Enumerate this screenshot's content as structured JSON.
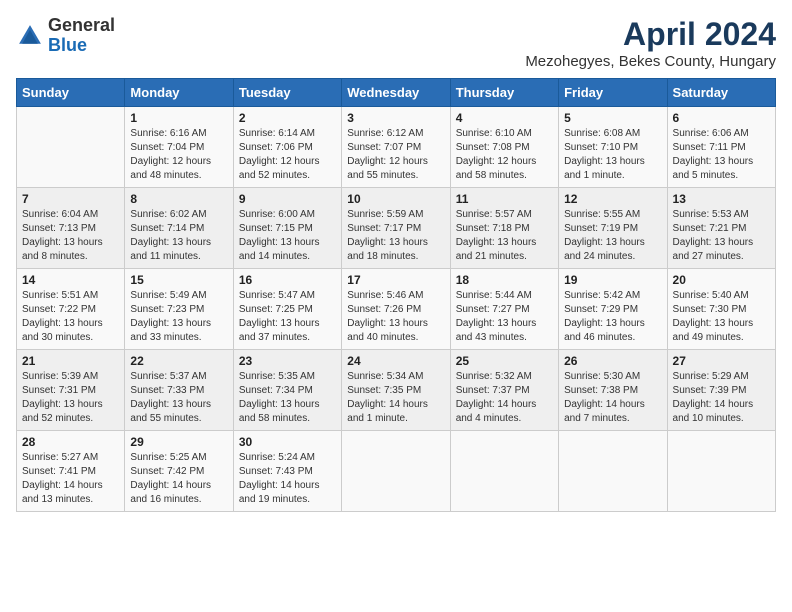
{
  "logo": {
    "general": "General",
    "blue": "Blue"
  },
  "header": {
    "title": "April 2024",
    "subtitle": "Mezohegyes, Bekes County, Hungary"
  },
  "weekdays": [
    "Sunday",
    "Monday",
    "Tuesday",
    "Wednesday",
    "Thursday",
    "Friday",
    "Saturday"
  ],
  "weeks": [
    [
      {
        "day": "",
        "sunrise": "",
        "sunset": "",
        "daylight": ""
      },
      {
        "day": "1",
        "sunrise": "Sunrise: 6:16 AM",
        "sunset": "Sunset: 7:04 PM",
        "daylight": "Daylight: 12 hours and 48 minutes."
      },
      {
        "day": "2",
        "sunrise": "Sunrise: 6:14 AM",
        "sunset": "Sunset: 7:06 PM",
        "daylight": "Daylight: 12 hours and 52 minutes."
      },
      {
        "day": "3",
        "sunrise": "Sunrise: 6:12 AM",
        "sunset": "Sunset: 7:07 PM",
        "daylight": "Daylight: 12 hours and 55 minutes."
      },
      {
        "day": "4",
        "sunrise": "Sunrise: 6:10 AM",
        "sunset": "Sunset: 7:08 PM",
        "daylight": "Daylight: 12 hours and 58 minutes."
      },
      {
        "day": "5",
        "sunrise": "Sunrise: 6:08 AM",
        "sunset": "Sunset: 7:10 PM",
        "daylight": "Daylight: 13 hours and 1 minute."
      },
      {
        "day": "6",
        "sunrise": "Sunrise: 6:06 AM",
        "sunset": "Sunset: 7:11 PM",
        "daylight": "Daylight: 13 hours and 5 minutes."
      }
    ],
    [
      {
        "day": "7",
        "sunrise": "Sunrise: 6:04 AM",
        "sunset": "Sunset: 7:13 PM",
        "daylight": "Daylight: 13 hours and 8 minutes."
      },
      {
        "day": "8",
        "sunrise": "Sunrise: 6:02 AM",
        "sunset": "Sunset: 7:14 PM",
        "daylight": "Daylight: 13 hours and 11 minutes."
      },
      {
        "day": "9",
        "sunrise": "Sunrise: 6:00 AM",
        "sunset": "Sunset: 7:15 PM",
        "daylight": "Daylight: 13 hours and 14 minutes."
      },
      {
        "day": "10",
        "sunrise": "Sunrise: 5:59 AM",
        "sunset": "Sunset: 7:17 PM",
        "daylight": "Daylight: 13 hours and 18 minutes."
      },
      {
        "day": "11",
        "sunrise": "Sunrise: 5:57 AM",
        "sunset": "Sunset: 7:18 PM",
        "daylight": "Daylight: 13 hours and 21 minutes."
      },
      {
        "day": "12",
        "sunrise": "Sunrise: 5:55 AM",
        "sunset": "Sunset: 7:19 PM",
        "daylight": "Daylight: 13 hours and 24 minutes."
      },
      {
        "day": "13",
        "sunrise": "Sunrise: 5:53 AM",
        "sunset": "Sunset: 7:21 PM",
        "daylight": "Daylight: 13 hours and 27 minutes."
      }
    ],
    [
      {
        "day": "14",
        "sunrise": "Sunrise: 5:51 AM",
        "sunset": "Sunset: 7:22 PM",
        "daylight": "Daylight: 13 hours and 30 minutes."
      },
      {
        "day": "15",
        "sunrise": "Sunrise: 5:49 AM",
        "sunset": "Sunset: 7:23 PM",
        "daylight": "Daylight: 13 hours and 33 minutes."
      },
      {
        "day": "16",
        "sunrise": "Sunrise: 5:47 AM",
        "sunset": "Sunset: 7:25 PM",
        "daylight": "Daylight: 13 hours and 37 minutes."
      },
      {
        "day": "17",
        "sunrise": "Sunrise: 5:46 AM",
        "sunset": "Sunset: 7:26 PM",
        "daylight": "Daylight: 13 hours and 40 minutes."
      },
      {
        "day": "18",
        "sunrise": "Sunrise: 5:44 AM",
        "sunset": "Sunset: 7:27 PM",
        "daylight": "Daylight: 13 hours and 43 minutes."
      },
      {
        "day": "19",
        "sunrise": "Sunrise: 5:42 AM",
        "sunset": "Sunset: 7:29 PM",
        "daylight": "Daylight: 13 hours and 46 minutes."
      },
      {
        "day": "20",
        "sunrise": "Sunrise: 5:40 AM",
        "sunset": "Sunset: 7:30 PM",
        "daylight": "Daylight: 13 hours and 49 minutes."
      }
    ],
    [
      {
        "day": "21",
        "sunrise": "Sunrise: 5:39 AM",
        "sunset": "Sunset: 7:31 PM",
        "daylight": "Daylight: 13 hours and 52 minutes."
      },
      {
        "day": "22",
        "sunrise": "Sunrise: 5:37 AM",
        "sunset": "Sunset: 7:33 PM",
        "daylight": "Daylight: 13 hours and 55 minutes."
      },
      {
        "day": "23",
        "sunrise": "Sunrise: 5:35 AM",
        "sunset": "Sunset: 7:34 PM",
        "daylight": "Daylight: 13 hours and 58 minutes."
      },
      {
        "day": "24",
        "sunrise": "Sunrise: 5:34 AM",
        "sunset": "Sunset: 7:35 PM",
        "daylight": "Daylight: 14 hours and 1 minute."
      },
      {
        "day": "25",
        "sunrise": "Sunrise: 5:32 AM",
        "sunset": "Sunset: 7:37 PM",
        "daylight": "Daylight: 14 hours and 4 minutes."
      },
      {
        "day": "26",
        "sunrise": "Sunrise: 5:30 AM",
        "sunset": "Sunset: 7:38 PM",
        "daylight": "Daylight: 14 hours and 7 minutes."
      },
      {
        "day": "27",
        "sunrise": "Sunrise: 5:29 AM",
        "sunset": "Sunset: 7:39 PM",
        "daylight": "Daylight: 14 hours and 10 minutes."
      }
    ],
    [
      {
        "day": "28",
        "sunrise": "Sunrise: 5:27 AM",
        "sunset": "Sunset: 7:41 PM",
        "daylight": "Daylight: 14 hours and 13 minutes."
      },
      {
        "day": "29",
        "sunrise": "Sunrise: 5:25 AM",
        "sunset": "Sunset: 7:42 PM",
        "daylight": "Daylight: 14 hours and 16 minutes."
      },
      {
        "day": "30",
        "sunrise": "Sunrise: 5:24 AM",
        "sunset": "Sunset: 7:43 PM",
        "daylight": "Daylight: 14 hours and 19 minutes."
      },
      {
        "day": "",
        "sunrise": "",
        "sunset": "",
        "daylight": ""
      },
      {
        "day": "",
        "sunrise": "",
        "sunset": "",
        "daylight": ""
      },
      {
        "day": "",
        "sunrise": "",
        "sunset": "",
        "daylight": ""
      },
      {
        "day": "",
        "sunrise": "",
        "sunset": "",
        "daylight": ""
      }
    ]
  ]
}
